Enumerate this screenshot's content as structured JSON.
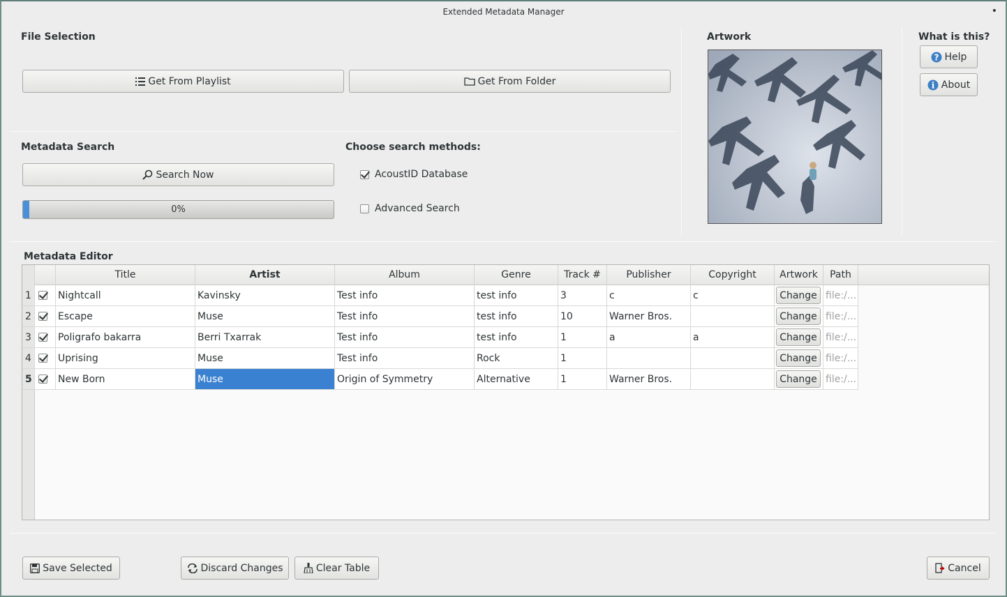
{
  "window": {
    "title": "Extended Metadata Manager"
  },
  "file_selection": {
    "title": "File Selection",
    "playlist_label": "Get From Playlist",
    "folder_label": "Get From Folder"
  },
  "metadata_search": {
    "title": "Metadata Search",
    "search_label": "Search Now",
    "progress_text": "0%",
    "progress_fraction": 0.005,
    "methods_title": "Choose search methods:",
    "methods": [
      {
        "label": "AcoustID Database",
        "checked": true
      },
      {
        "label": "Advanced Search",
        "checked": false
      }
    ]
  },
  "artwork": {
    "title": "Artwork"
  },
  "help_panel": {
    "title": "What is this?",
    "help_label": "Help",
    "about_label": "About"
  },
  "editor": {
    "title": "Metadata Editor",
    "columns": [
      "",
      "Title",
      "Artist",
      "Album",
      "Genre",
      "Track #",
      "Publisher",
      "Copyright",
      "Artwork",
      "Path"
    ],
    "rows": [
      {
        "num": "1",
        "checked": true,
        "title": "Nightcall",
        "artist": "Kavinsky",
        "album": "Test info",
        "genre": "test info",
        "track": "3",
        "publisher": "c",
        "copyright": "c",
        "artwork": "Change",
        "path": "file:/..."
      },
      {
        "num": "2",
        "checked": true,
        "title": "Escape",
        "artist": "Muse",
        "album": "Test info",
        "genre": "test info",
        "track": "10",
        "publisher": "Warner Bros.",
        "copyright": "",
        "artwork": "Change",
        "path": "file:/..."
      },
      {
        "num": "3",
        "checked": true,
        "title": "Poligrafo bakarra",
        "artist": "Berri Txarrak",
        "album": "Test info",
        "genre": "test info",
        "track": "1",
        "publisher": "a",
        "copyright": "a",
        "artwork": "Change",
        "path": "file:/..."
      },
      {
        "num": "4",
        "checked": true,
        "title": "Uprising",
        "artist": "Muse",
        "album": "Test info",
        "genre": "Rock",
        "track": "1",
        "publisher": "",
        "copyright": "",
        "artwork": "Change",
        "path": "file:/..."
      },
      {
        "num": "5",
        "checked": true,
        "title": "New Born",
        "artist": "Muse",
        "album": "Origin of Symmetry",
        "genre": "Alternative",
        "track": "1",
        "publisher": "Warner Bros.",
        "copyright": "",
        "artwork": "Change",
        "path": "file:/..."
      }
    ],
    "selected_row": 4,
    "selected_col": "artist"
  },
  "footer": {
    "save_label": "Save Selected",
    "discard_label": "Discard Changes",
    "clear_label": "Clear Table",
    "cancel_label": "Cancel"
  },
  "colors": {
    "selection": "#3a81d1",
    "progress": "#4a90d9",
    "border_accent": "#6f8f86"
  }
}
